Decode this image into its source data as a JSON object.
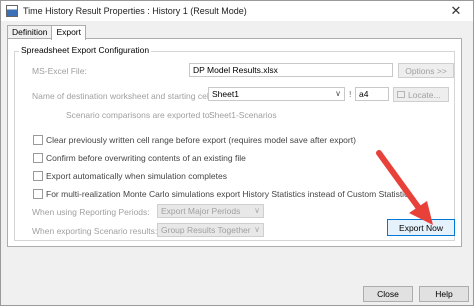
{
  "window": {
    "title": "Time History Result Properties : History 1 (Result Mode)",
    "close_glyph": "✕"
  },
  "tabs": [
    {
      "label": "Definition"
    },
    {
      "label": "Export"
    }
  ],
  "group": {
    "title": "Spreadsheet Export Configuration"
  },
  "excel_file": {
    "label": "MS-Excel File:",
    "value": "DP Model Results.xlsx",
    "options_button": "Options >>"
  },
  "worksheet": {
    "label": "Name of destination worksheet and starting cell:",
    "sheet_value": "Sheet1",
    "separator": "!",
    "cell_value": "a4",
    "locate_button": "Locate..."
  },
  "scenario_export": {
    "label": "Scenario comparisons are exported to:",
    "value": "Sheet1-Scenarios"
  },
  "checkboxes": [
    {
      "label": "Clear previously written cell range before export (requires model save after export)",
      "checked": false
    },
    {
      "label": "Confirm before overwriting contents of an existing file",
      "checked": false
    },
    {
      "label": "Export automatically when simulation completes",
      "checked": false
    },
    {
      "label": "For multi-realization Monte Carlo simulations export History Statistics instead of Custom Statistic",
      "checked": false
    }
  ],
  "reporting_periods": {
    "label": "When using Reporting Periods:",
    "value": "Export Major Periods"
  },
  "scenario_results": {
    "label": "When exporting Scenario results:",
    "value": "Group Results Together"
  },
  "export_button": "Export Now",
  "footer": {
    "close_button": "Close",
    "help_button": "Help"
  },
  "colors": {
    "annotation_arrow": "#e8413a",
    "focus_border": "#0078d7"
  },
  "icons": {
    "app": "app-window-icon",
    "close": "close-icon",
    "chevron": "chevron-down-icon",
    "annotation": "red-arrow-annotation"
  }
}
